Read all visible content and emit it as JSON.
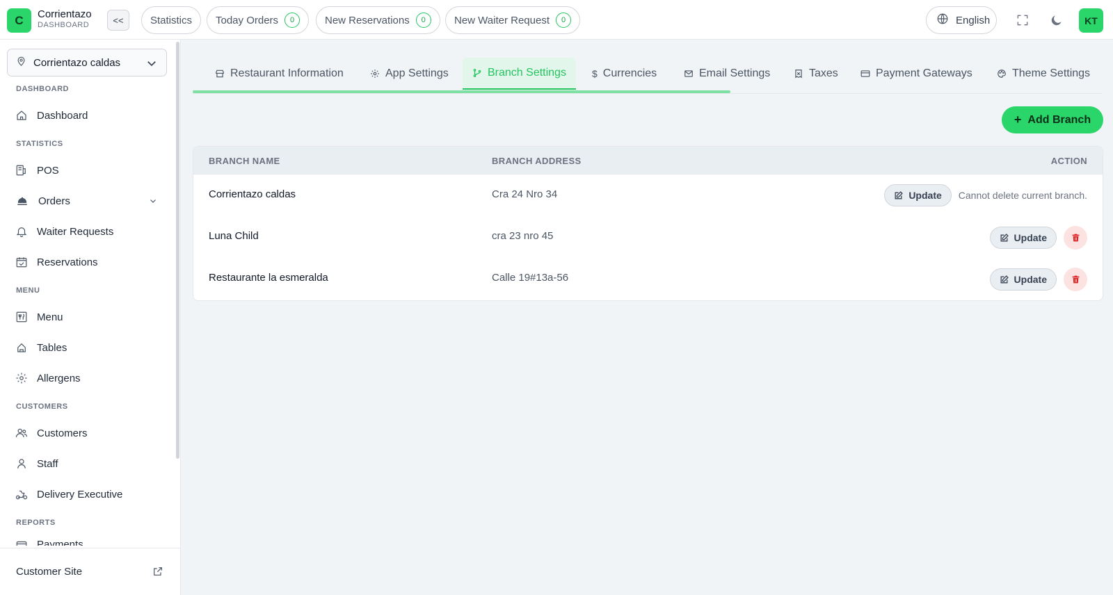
{
  "app": {
    "logo_letter": "C",
    "name": "Corrientazo",
    "subtitle": "DASHBOARD",
    "collapse_label": "<<"
  },
  "topbar": {
    "statistics": "Statistics",
    "today_orders": {
      "label": "Today Orders",
      "count": "0"
    },
    "new_reservations": {
      "label": "New Reservations",
      "count": "0"
    },
    "new_waiter_request": {
      "label": "New Waiter Request",
      "count": "0"
    },
    "language": "English",
    "user_initials": "KT"
  },
  "sidebar": {
    "branch": "Corrientazo caldas",
    "sections": {
      "dashboard": "DASHBOARD",
      "statistics": "STATISTICS",
      "menu": "MENU",
      "customers": "CUSTOMERS",
      "reports": "REPORTS"
    },
    "items": {
      "dashboard": "Dashboard",
      "pos": "POS",
      "orders": "Orders",
      "waiter_requests": "Waiter Requests",
      "reservations": "Reservations",
      "menu": "Menu",
      "tables": "Tables",
      "allergens": "Allergens",
      "customers": "Customers",
      "staff": "Staff",
      "delivery_executive": "Delivery Executive",
      "payments": "Payments"
    },
    "footer": "Customer Site"
  },
  "tabs": {
    "restaurant_information": "Restaurant Information",
    "app_settings": "App Settings",
    "branch_settings": "Branch Settings",
    "currencies": "Currencies",
    "email_settings": "Email Settings",
    "taxes": "Taxes",
    "payment_gateways": "Payment Gateways",
    "theme_settings": "Theme Settings",
    "active": "branch_settings"
  },
  "add_branch_label": "Add Branch",
  "table": {
    "headers": {
      "name": "BRANCH NAME",
      "address": "BRANCH ADDRESS",
      "action": "ACTION"
    },
    "update_label": "Update",
    "cannot_delete_note": "Cannot delete current branch.",
    "rows": [
      {
        "name": "Corrientazo caldas",
        "address": "Cra 24 Nro 34"
      },
      {
        "name": "Luna Child",
        "address": "cra 23 nro 45"
      },
      {
        "name": "Restaurante la esmeralda",
        "address": "Calle 19#13a-56"
      }
    ]
  },
  "colors": {
    "accent": "#2ad66a",
    "danger": "#dc2626"
  }
}
